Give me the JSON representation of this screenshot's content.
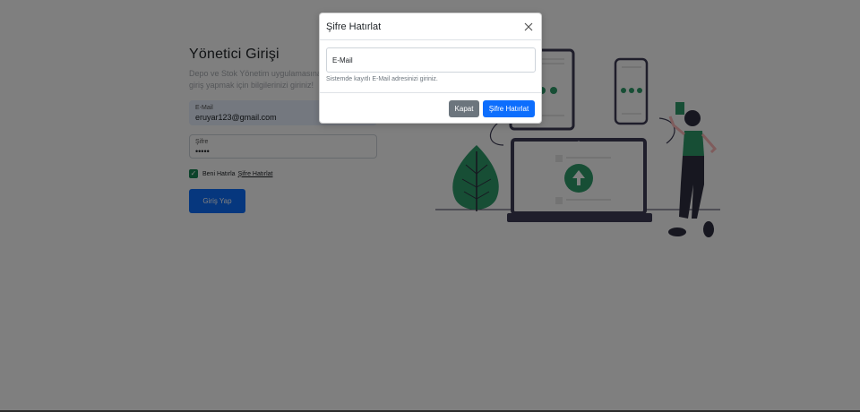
{
  "login": {
    "title": "Yönetici Girişi",
    "subtitle": "Depo ve Stok Yönetim uygulamasına giriş yapmak için bilgilerinizi giriniz!",
    "email_label": "E-Mail",
    "email_value": "eruyar123@gmail.com",
    "password_label": "Şifre",
    "password_value": "•••••",
    "remember_label": "Beni Hatırla",
    "forgot_link": "Şifre Hatırlat",
    "login_button": "Giriş Yap"
  },
  "modal": {
    "title": "Şifre Hatırlat",
    "close_icon": "close-icon",
    "email_placeholder": "E-Mail",
    "help_text": "Sistemde kayıtlı E-Mail adresinizi giriniz.",
    "cancel_button": "Kapat",
    "submit_button": "Şifre Hatırlat"
  },
  "colors": {
    "primary": "#0d6efd",
    "secondary": "#6c757d",
    "accent_green": "#2e9d6b",
    "backdrop": "rgba(0,0,0,0.5)"
  }
}
